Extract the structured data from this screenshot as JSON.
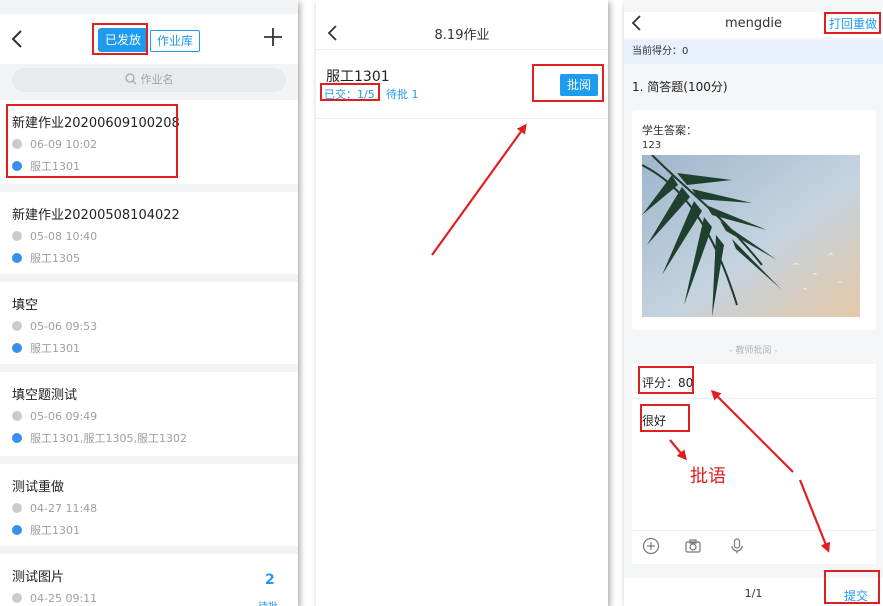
{
  "panel1": {
    "tab_sent": "已发放",
    "tab_library": "作业库",
    "search_placeholder": "作业名",
    "assignments": [
      {
        "title": "新建作业20200609100208",
        "time": "06-09 10:02",
        "class": "服工1301"
      },
      {
        "title": "新建作业20200508104022",
        "time": "05-08 10:40",
        "class": "服工1305"
      },
      {
        "title": "填空",
        "time": "05-06 09:53",
        "class": "服工1301"
      },
      {
        "title": "填空题测试",
        "time": "05-06 09:49",
        "class": "服工1301,服工1305,服工1302"
      },
      {
        "title": "测试重做",
        "time": "04-27 11:48",
        "class": "服工1301"
      },
      {
        "title": "测试图片",
        "time": "04-25 09:11",
        "class": ""
      }
    ],
    "pending_count": "2",
    "pending_label": "待批"
  },
  "panel2": {
    "title": "8.19作业",
    "class_name": "服工1301",
    "submitted": "已交：1/5",
    "to_review": "待批 1",
    "review_button": "批阅"
  },
  "panel3": {
    "title": "mengdie",
    "redo_button": "打回重做",
    "current_score": "当前得分：0",
    "question_title": "1. 简答题(100分)",
    "student_answer_label": "学生答案：",
    "student_answer_value": "123",
    "teacher_review_label": "- 教师批阅 -",
    "score_text": "评分：80",
    "comment_text": "很好",
    "annotation_label": "批语",
    "pager": "1/1",
    "submit_button": "提交"
  },
  "colors": {
    "accent": "#1e9bef",
    "annotation_red": "#e02020"
  },
  "icons": [
    "back-arrow-icon",
    "plus-icon",
    "search-icon",
    "clock-icon",
    "class-icon",
    "add-circle-icon",
    "camera-icon",
    "microphone-icon"
  ]
}
